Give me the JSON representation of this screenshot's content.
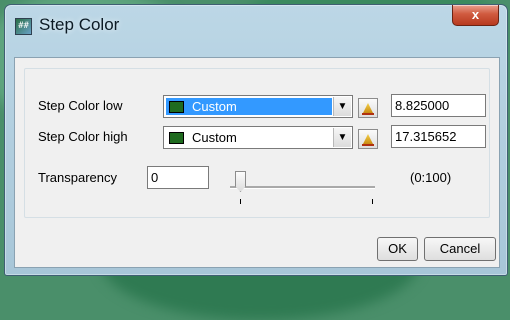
{
  "window": {
    "title": "Step Color",
    "close_glyph": "x",
    "icon_glyph": "##"
  },
  "rows": [
    {
      "label": "Step Color low",
      "color_name": "Custom",
      "swatch_color": "#1f6b1f",
      "value": "8.825000",
      "selected": true
    },
    {
      "label": "Step Color high",
      "color_name": "Custom",
      "swatch_color": "#1f6b1f",
      "value": "17.315652",
      "selected": false
    }
  ],
  "transparency": {
    "label": "Transparency",
    "value": "0",
    "range_label": "(0:100)",
    "slider_level": 0
  },
  "buttons": {
    "ok": "OK",
    "cancel": "Cancel"
  },
  "icons": {
    "dropdown": "chevron-down-icon",
    "picker": "color-picker-icon",
    "app": "app-icon",
    "close": "close-icon"
  },
  "colors": {
    "selection": "#3399ff",
    "swatch": "#1f6b1f",
    "close": "#c8472b"
  }
}
